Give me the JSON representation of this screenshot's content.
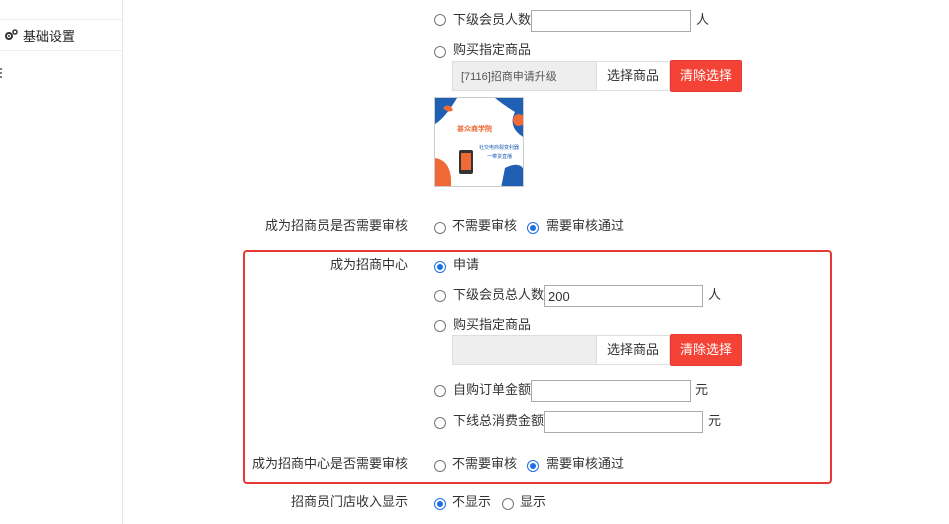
{
  "sidebar": {
    "items": [
      {
        "label": "基础设置",
        "icon": "gears-icon"
      }
    ]
  },
  "recruiter_conditions": {
    "sub_member_count": {
      "label": "下级会员人数",
      "value": "",
      "unit": "人"
    },
    "buy_goods": {
      "label": "购买指定商品",
      "goods_name": "[7116]招商申请升级",
      "select_button": "选择商品",
      "clear_button": "清除选择",
      "thumbnail": {
        "title": "甚众商学院",
        "line1": "社交电商裂变利器",
        "line2": "一带货直播"
      }
    }
  },
  "recruiter_audit": {
    "label": "成为招商员是否需要审核",
    "options": [
      "不需要审核",
      "需要审核通过"
    ],
    "selected": "需要审核通过"
  },
  "center": {
    "label": "成为招商中心",
    "apply_label": "申请",
    "sub_total": {
      "label": "下级会员总人数",
      "value": "200",
      "unit": "人"
    },
    "buy_goods": {
      "label": "购买指定商品",
      "goods_name": "",
      "select_button": "选择商品",
      "clear_button": "清除选择"
    },
    "self_order": {
      "label": "自购订单金额",
      "value": "",
      "unit": "元"
    },
    "downline_spend": {
      "label": "下线总消费金额",
      "value": "",
      "unit": "元"
    },
    "audit": {
      "label": "成为招商中心是否需要审核",
      "options": [
        "不需要审核",
        "需要审核通过"
      ],
      "selected": "需要审核通过"
    }
  },
  "store_income": {
    "label": "招商员门店收入显示",
    "options": [
      "不显示",
      "显示"
    ],
    "selected": "不显示"
  },
  "colors": {
    "accent": "#1e6fe0",
    "danger": "#f44336",
    "highlight_frame": "#e53935"
  }
}
